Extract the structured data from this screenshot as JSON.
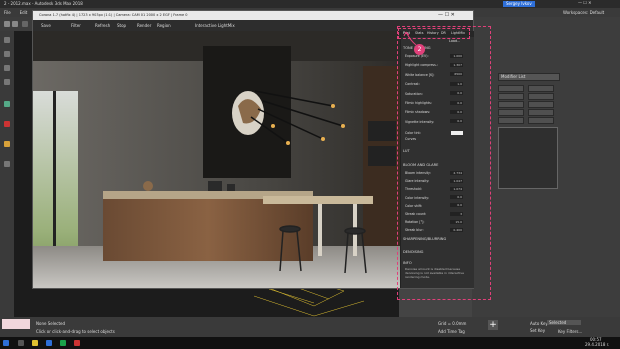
{
  "window": {
    "title": "2 - 2012.max - Autodesk 3ds Max 2018",
    "workspace": "Workspaces: Default",
    "user": "Sergey Ivkov"
  },
  "menu": [
    "File",
    "Edit",
    "Tools",
    "Group",
    "Views",
    "Create",
    "Modifiers",
    "Animation",
    "Graph Editors",
    "Rendering",
    "Civil View",
    "Customize",
    "Scripting",
    "Corona",
    "Content",
    "Help"
  ],
  "vfb": {
    "title": "Corona 1.7 (hotfix 4) | 1723 x 903px (1:1) | Camera: CAM 01 2000 x 2 EGF | Frame 0",
    "toolbar": [
      "Save",
      "Filter",
      "Refresh",
      "Stop",
      "Render",
      "Region",
      "Interactive LightMix"
    ],
    "tabs": [
      "Post",
      "Stats",
      "History",
      "DR",
      "LightMix"
    ],
    "load_label": "Load...",
    "tone_mapping": {
      "header": "TONE MAPPING",
      "rows": [
        {
          "label": "Exposure (EV):",
          "value": "1.000"
        },
        {
          "label": "Highlight compress.:",
          "value": "1.307"
        },
        {
          "label": "White balance [K]:",
          "value": "6500"
        },
        {
          "label": "Contrast:",
          "value": "1.0"
        },
        {
          "label": "Saturation:",
          "value": "0.0"
        },
        {
          "label": "Filmic highlights:",
          "value": "0.0"
        },
        {
          "label": "Filmic shadows:",
          "value": "0.0"
        },
        {
          "label": "Vignette intensity:",
          "value": "0.0"
        }
      ],
      "color_tint_label": "Color tint:",
      "curves_label": "Curves"
    },
    "lut_header": "LUT",
    "bloom": {
      "header": "BLOOM AND GLARE",
      "rows": [
        {
          "label": "Bloom intensity:",
          "value": "2.734"
        },
        {
          "label": "Glare intensity:",
          "value": "1.047"
        },
        {
          "label": "Threshold:",
          "value": "1.074"
        },
        {
          "label": "Color intensity:",
          "value": "0.0"
        },
        {
          "label": "Color shift:",
          "value": "0.0"
        },
        {
          "label": "Streak count:",
          "value": "3"
        },
        {
          "label": "Rotation [°]:",
          "value": "15.0"
        },
        {
          "label": "Streak blur:",
          "value": "0.400"
        }
      ]
    },
    "sharpening_header": "SHARPENING/BLURRING",
    "denoising_header": "DENOISING",
    "info": {
      "header": "INFO",
      "text": "Denoise amount is disabled because denoising is not available in interactive rendering mode."
    },
    "annotation": "2"
  },
  "command_panel": {
    "modifier_list": "Modifier List",
    "buttons": [
      "",
      "",
      "",
      "",
      "",
      "",
      "",
      "",
      "",
      ""
    ]
  },
  "bottom": {
    "status_selected": "None Selected",
    "status_hint": "Click or click-and-drag to select objects",
    "grid": "Grid = 0.0mm",
    "add_time_tag": "Add Time Tag",
    "auto_key": "Auto Key",
    "set_key": "Set Key",
    "selected": "Selected",
    "key_filters": "Key Filters..."
  },
  "taskbar": {
    "time": "00:57",
    "date": "29.4.2018 r."
  },
  "colors": {
    "accent_pink": "#e0407a",
    "brand_blue": "#2e6fd8"
  }
}
